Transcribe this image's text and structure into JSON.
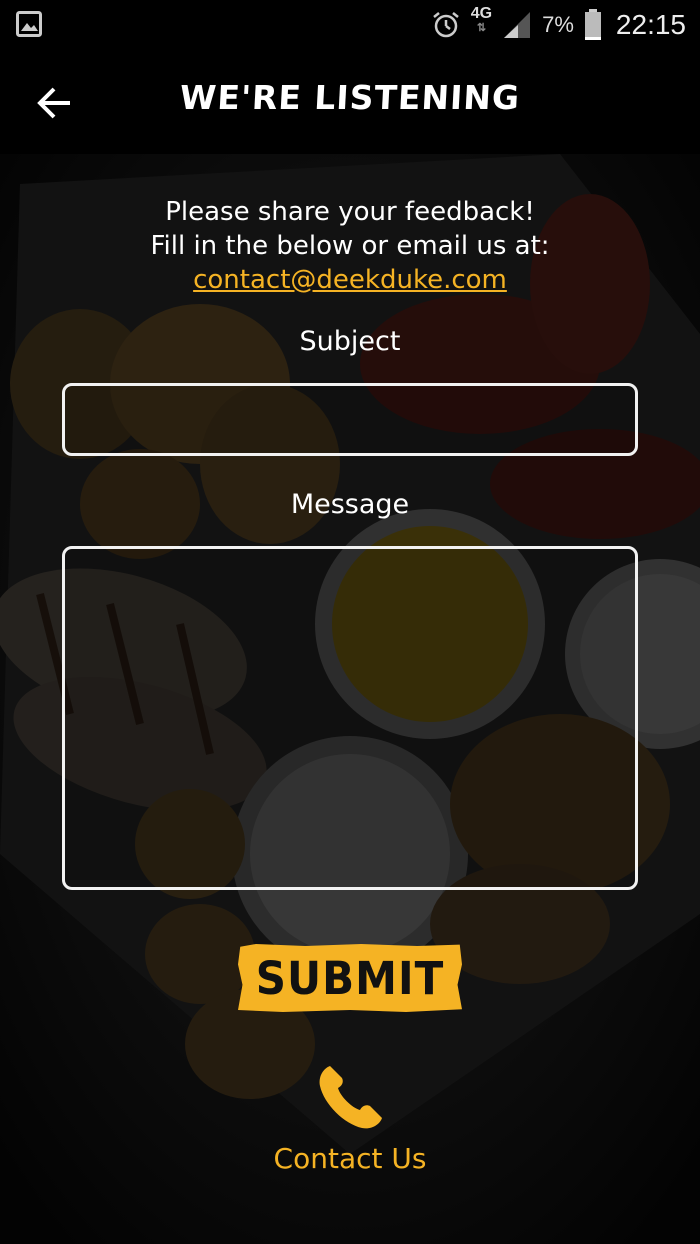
{
  "status_bar": {
    "network": "4G",
    "battery_percent": "7%",
    "time": "22:15",
    "icons": [
      "gallery-icon",
      "alarm-icon",
      "network-arrows-icon",
      "signal-icon",
      "battery-icon"
    ]
  },
  "app_bar": {
    "title": "WE'RE LISTENING",
    "back_icon": "arrow-left-icon"
  },
  "intro": {
    "line1": "Please share your feedback!",
    "line2": "Fill in the below or email us at:",
    "email": "contact@deekduke.com"
  },
  "form": {
    "subject_label": "Subject",
    "subject_value": "",
    "message_label": "Message",
    "message_value": "",
    "submit_label": "SUBMIT"
  },
  "contact": {
    "label": "Contact Us",
    "icon": "phone-icon"
  },
  "colors": {
    "accent": "#f5b324",
    "background": "#000000",
    "text": "#ffffff"
  }
}
